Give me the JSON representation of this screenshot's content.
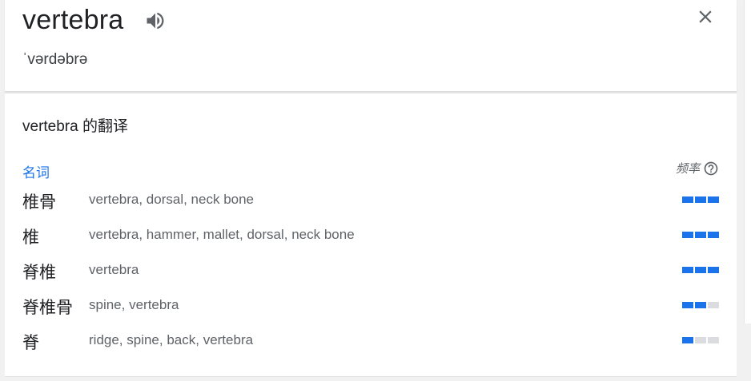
{
  "header": {
    "word": "vertebra",
    "phonetic": "ˈvərdəbrə",
    "speaker_icon": "volume-icon",
    "close_icon": "close-icon"
  },
  "translations": {
    "title": "vertebra 的翻译",
    "part_of_speech": "名词",
    "frequency_label": "频率",
    "help_icon": "help-circle-icon",
    "accent_color": "#1a73e8",
    "rows": [
      {
        "zh": "椎骨",
        "en": "vertebra, dorsal, neck bone",
        "frequency": 3
      },
      {
        "zh": "椎",
        "en": "vertebra, hammer, mallet, dorsal, neck bone",
        "frequency": 3
      },
      {
        "zh": "脊椎",
        "en": "vertebra",
        "frequency": 3
      },
      {
        "zh": "脊椎骨",
        "en": "spine, vertebra",
        "frequency": 2
      },
      {
        "zh": "脊",
        "en": "ridge, spine, back, vertebra",
        "frequency": 1
      }
    ]
  }
}
